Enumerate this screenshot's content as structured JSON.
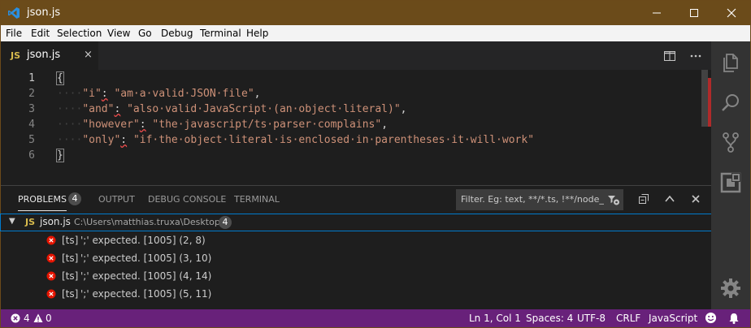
{
  "titlebar": {
    "title": "json.js"
  },
  "menu": [
    "File",
    "Edit",
    "Selection",
    "View",
    "Go",
    "Debug",
    "Terminal",
    "Help"
  ],
  "tab": {
    "lang_badge": "JS",
    "filename": "json.js",
    "close": "×"
  },
  "editor": {
    "line_numbers": [
      "1",
      "2",
      "3",
      "4",
      "5",
      "6"
    ]
  },
  "panel": {
    "tabs": [
      "PROBLEMS",
      "OUTPUT",
      "DEBUG CONSOLE",
      "TERMINAL"
    ],
    "problem_count": "4",
    "filter_placeholder": "Filter. Eg: text, **/*.ts, !**/node_...",
    "file": {
      "lang_badge": "JS",
      "name": "json.js",
      "path": "C:\\Users\\matthias.truxa\\Desktop",
      "count": "4"
    },
    "problems": [
      {
        "source": "[ts]",
        "message": "';' expected. [1005] (2, 8)"
      },
      {
        "source": "[ts]",
        "message": "';' expected. [1005] (3, 10)"
      },
      {
        "source": "[ts]",
        "message": "';' expected. [1005] (4, 14)"
      },
      {
        "source": "[ts]",
        "message": "';' expected. [1005] (5, 11)"
      }
    ]
  },
  "status": {
    "errors": "4",
    "warnings": "0",
    "position": "Ln 1, Col 1",
    "spaces": "Spaces: 4",
    "encoding": "UTF-8",
    "eol": "CRLF",
    "language": "JavaScript"
  },
  "colors": {
    "titlebar": "#6b4b1a",
    "statusbar": "#68217a",
    "accent": "#007acc",
    "error": "#f14c4c"
  }
}
